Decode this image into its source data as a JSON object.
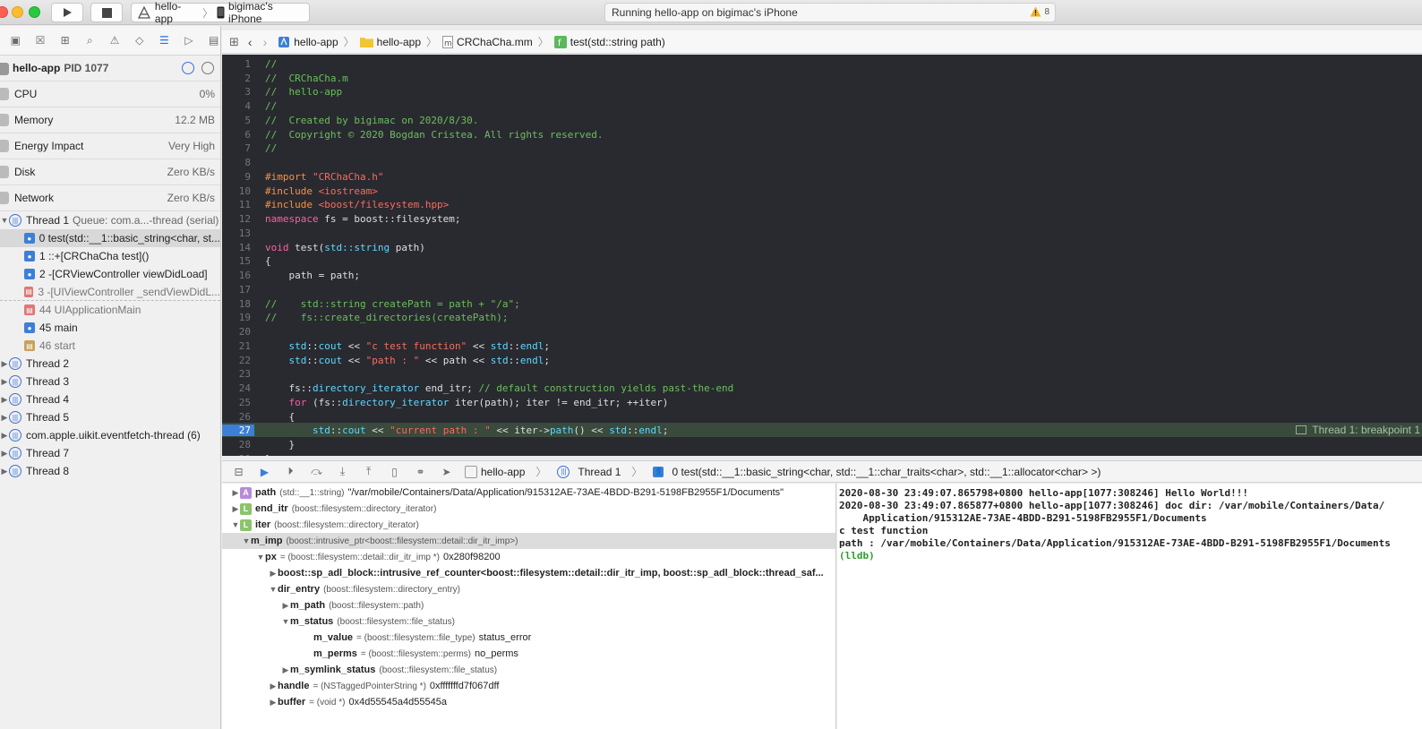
{
  "toolbar": {
    "scheme_target": "hello-app",
    "device": "bigimac's iPhone",
    "status_text": "Running hello-app on bigimac's iPhone",
    "warning_count": "8"
  },
  "navigator": {
    "process_name": "hello-app",
    "pid": "PID 1077",
    "gauges": [
      {
        "label": "CPU",
        "value": "0%"
      },
      {
        "label": "Memory",
        "value": "12.2 MB"
      },
      {
        "label": "Energy Impact",
        "value": "Very High"
      },
      {
        "label": "Disk",
        "value": "Zero KB/s"
      },
      {
        "label": "Network",
        "value": "Zero KB/s"
      }
    ],
    "thread1": "Thread 1",
    "thread1_queue": "Queue: com.a...-thread (serial)",
    "frames": [
      "0 test(std::__1::basic_string<char, st...",
      "1 ::+[CRChaCha test]()",
      "2 -[CRViewController viewDidLoad]",
      "3 -[UIViewController _sendViewDidL...",
      "44 UIApplicationMain",
      "45 main",
      "46 start"
    ],
    "threads": [
      "Thread 2",
      "Thread 3",
      "Thread 4",
      "Thread 5",
      "com.apple.uikit.eventfetch-thread (6)",
      "Thread 7",
      "Thread 8"
    ]
  },
  "jumpbar": {
    "project": "hello-app",
    "group": "hello-app",
    "file": "CRChaCha.mm",
    "symbol": "test(std::string path)"
  },
  "editor": {
    "breakpoint_label": "Thread 1: breakpoint 1"
  },
  "debugbar": {
    "process": "hello-app",
    "thread": "Thread 1",
    "frame": "0 test(std::__1::basic_string<char, std::__1::char_traits<char>, std::__1::allocator<char> >)"
  },
  "variables": [
    {
      "badge": "A",
      "name": "path",
      "type": "(std::__1::string)",
      "value": "\"/var/mobile/Containers/Data/Application/915312AE-73AE-4BDD-B291-5198FB2955F1/Documents\""
    },
    {
      "badge": "L",
      "name": "end_itr",
      "type": "(boost::filesystem::directory_iterator)",
      "value": ""
    },
    {
      "badge": "L",
      "name": "iter",
      "type": "(boost::filesystem::directory_iterator)",
      "value": ""
    },
    {
      "badge": "",
      "name": "m_imp",
      "type": "(boost::intrusive_ptr<boost::filesystem::detail::dir_itr_imp>)",
      "value": ""
    },
    {
      "badge": "",
      "name": "px",
      "type": "= (boost::filesystem::detail::dir_itr_imp *)",
      "value": "0x280f98200"
    },
    {
      "badge": "",
      "name": "boost::sp_adl_block::intrusive_ref_counter<boost::filesystem::detail::dir_itr_imp, boost::sp_adl_block::thread_saf...",
      "type": "",
      "value": ""
    },
    {
      "badge": "",
      "name": "dir_entry",
      "type": "(boost::filesystem::directory_entry)",
      "value": ""
    },
    {
      "badge": "",
      "name": "m_path",
      "type": "(boost::filesystem::path)",
      "value": ""
    },
    {
      "badge": "",
      "name": "m_status",
      "type": "(boost::filesystem::file_status)",
      "value": ""
    },
    {
      "badge": "",
      "name": "m_value",
      "type": "= (boost::filesystem::file_type)",
      "value": "status_error"
    },
    {
      "badge": "",
      "name": "m_perms",
      "type": "= (boost::filesystem::perms)",
      "value": "no_perms"
    },
    {
      "badge": "",
      "name": "m_symlink_status",
      "type": "(boost::filesystem::file_status)",
      "value": ""
    },
    {
      "badge": "",
      "name": "handle",
      "type": "= (NSTaggedPointerString *)",
      "value": "0xfffffffd7f067dff"
    },
    {
      "badge": "",
      "name": "buffer",
      "type": "= (void *)",
      "value": "0x4d55545a4d55545a"
    }
  ],
  "console": [
    "2020-08-30 23:49:07.865798+0800 hello-app[1077:308246] Hello World!!!",
    "2020-08-30 23:49:07.865877+0800 hello-app[1077:308246] doc dir: /var/mobile/Containers/Data/",
    "    Application/915312AE-73AE-4BDD-B291-5198FB2955F1/Documents",
    "c test function",
    "path : /var/mobile/Containers/Data/Application/915312AE-73AE-4BDD-B291-5198FB2955F1/Documents",
    "(lldb)"
  ]
}
